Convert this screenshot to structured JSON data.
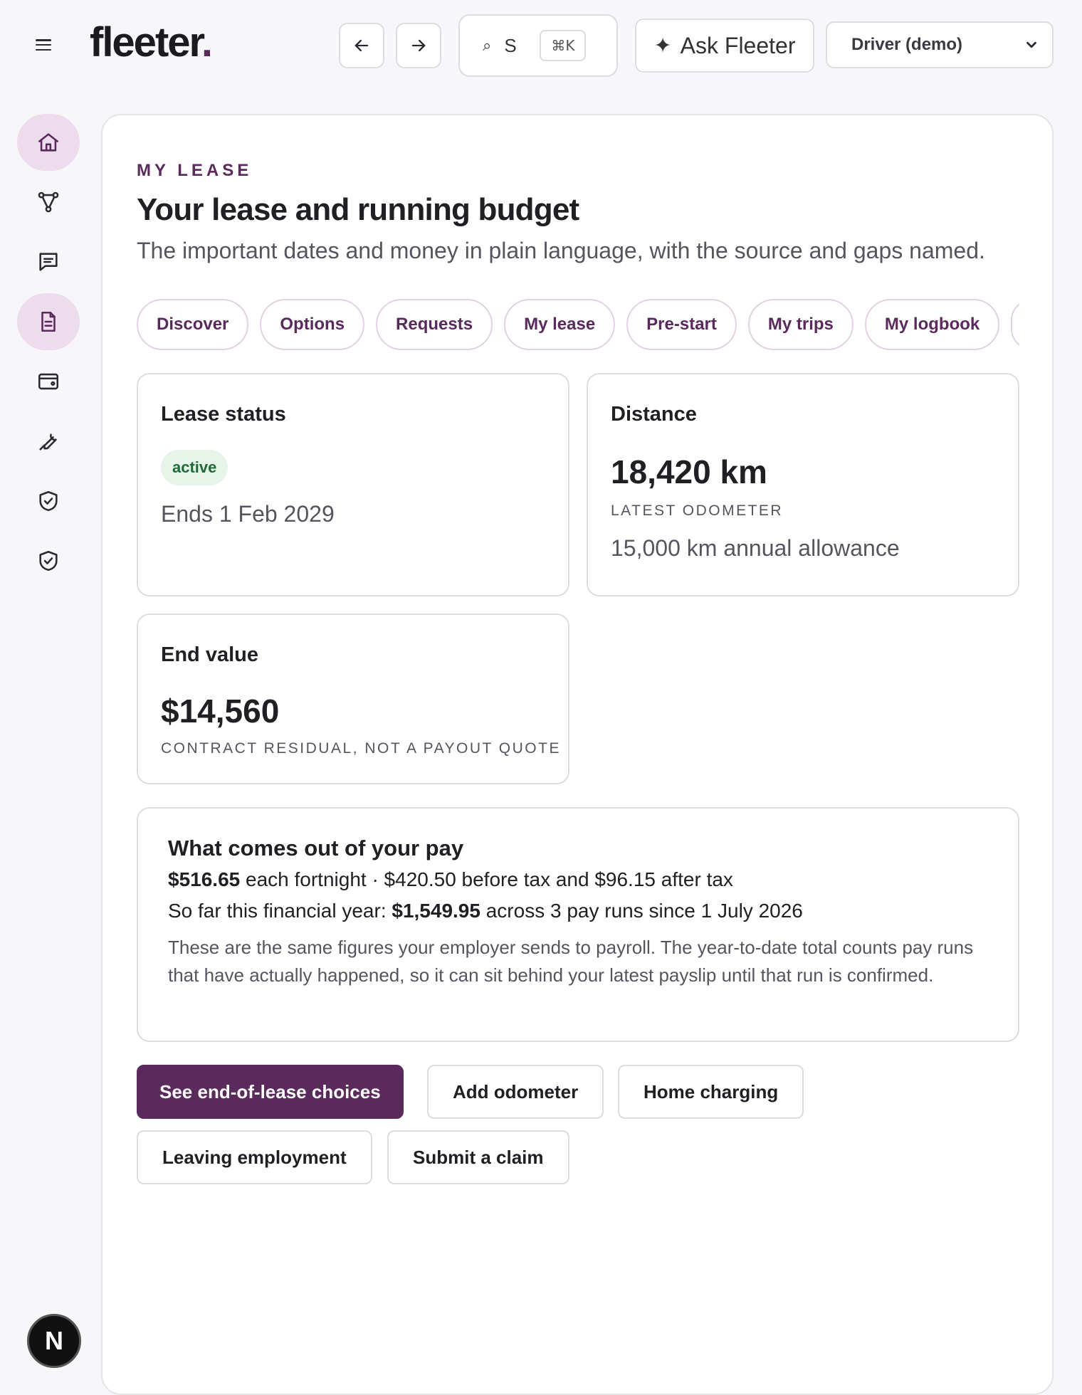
{
  "app": {
    "logo_text": "fleeter",
    "logo_dot": ".",
    "brand_color": "#5b2a5c"
  },
  "header": {
    "back_icon": "arrow-left-icon",
    "forward_icon": "arrow-right-icon",
    "search": {
      "glyph": "⌕",
      "value": "S",
      "shortcut": "⌘K"
    },
    "ask_label": "Ask Fleeter",
    "ask_glyph": "✦",
    "role_selected": "Driver (demo)"
  },
  "sidebar": {
    "items": [
      {
        "icon": "home-icon",
        "active": true
      },
      {
        "icon": "network-icon",
        "active": false
      },
      {
        "icon": "chat-icon",
        "active": false
      },
      {
        "icon": "document-icon",
        "active": true
      },
      {
        "icon": "wallet-icon",
        "active": false
      },
      {
        "icon": "wrench-icon",
        "active": false
      },
      {
        "icon": "shield-check-icon",
        "active": false
      },
      {
        "icon": "shield-check-icon",
        "active": false
      }
    ],
    "avatar_letter": "N"
  },
  "page": {
    "eyebrow": "MY LEASE",
    "title": "Your lease and running budget",
    "subtitle": "The important dates and money in plain language, with the source and gaps named."
  },
  "tabs": [
    "Discover",
    "Options",
    "Requests",
    "My lease",
    "Pre-start",
    "My trips",
    "My logbook"
  ],
  "lease_status": {
    "title": "Lease status",
    "badge": "active",
    "ends": "Ends 1 Feb 2029"
  },
  "distance": {
    "title": "Distance",
    "value": "18,420 km",
    "label": "LATEST ODOMETER",
    "allowance": "15,000 km annual allowance"
  },
  "end_value": {
    "title": "End value",
    "value": "$14,560",
    "label": "CONTRACT RESIDUAL, NOT A PAYOUT QUOTE"
  },
  "pay": {
    "title": "What comes out of your pay",
    "fortnight_amount": "$516.65",
    "fortnight_rest": " each fortnight · $420.50 before tax and $96.15 after tax",
    "ytd_prefix": "So far this financial year: ",
    "ytd_amount": "$1,549.95",
    "ytd_rest": " across 3 pay runs since 1 July 2026",
    "note": "These are the same figures your employer sends to payroll. The year-to-date total counts pay runs that have actually happened, so it can sit behind your latest payslip until that run is confirmed."
  },
  "actions": {
    "end_of_lease": "See end-of-lease choices",
    "add_odometer": "Add odometer",
    "home_charging": "Home charging",
    "leaving_employment": "Leaving employment",
    "submit_claim": "Submit a claim"
  }
}
